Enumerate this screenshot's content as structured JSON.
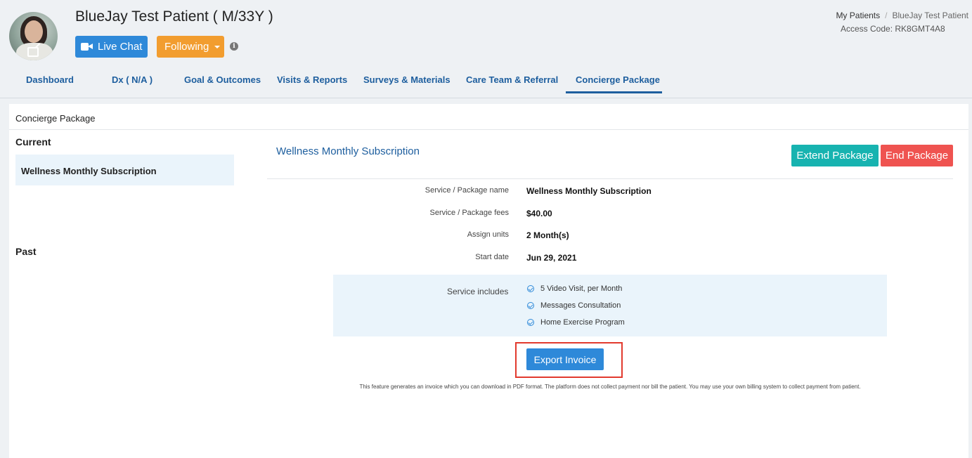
{
  "header": {
    "patient_title": "BlueJay Test Patient ( M/33Y )",
    "live_chat_label": "Live Chat",
    "following_label": "Following",
    "access_code": "Access Code: RK8GMT4A8"
  },
  "breadcrumb": {
    "items": [
      "My Patients",
      "BlueJay Test Patient"
    ],
    "separator": "/"
  },
  "tabs": [
    {
      "label": "Dashboard",
      "active": false
    },
    {
      "label": "Dx ( N/A )",
      "active": false
    },
    {
      "label": "Goal & Outcomes",
      "active": false
    },
    {
      "label": "Visits & Reports",
      "active": false
    },
    {
      "label": "Surveys & Materials",
      "active": false
    },
    {
      "label": "Care Team & Referral",
      "active": false
    },
    {
      "label": "Concierge Package",
      "active": true
    }
  ],
  "panel": {
    "title": "Concierge Package",
    "current_heading": "Current",
    "current_item": "Wellness Monthly Subscription",
    "past_heading": "Past"
  },
  "package": {
    "title": "Wellness Monthly Subscription",
    "extend_label": "Extend Package",
    "end_label": "End Package",
    "details": [
      {
        "label": "Service / Package name",
        "value": "Wellness Monthly Subscription"
      },
      {
        "label": "Service / Package fees",
        "value": "$40.00"
      },
      {
        "label": "Assign units",
        "value": "2 Month(s)"
      },
      {
        "label": "Start date",
        "value": "Jun 29, 2021"
      }
    ],
    "includes_label": "Service includes",
    "includes": [
      "5 Video Visit, per Month",
      "Messages Consultation",
      "Home Exercise Program"
    ],
    "export_label": "Export Invoice",
    "disclaimer": "This feature generates an invoice which you can download in PDF format. The platform does not collect payment nor bill the patient. You may use your own billing system to collect payment from patient."
  },
  "colors": {
    "primary_blue": "#2e89d9",
    "link_blue": "#1d5e9e",
    "following_orange": "#f29d2f",
    "extend_teal": "#17b3b0",
    "end_red": "#ef5350",
    "highlight_red": "#e23a2e"
  }
}
